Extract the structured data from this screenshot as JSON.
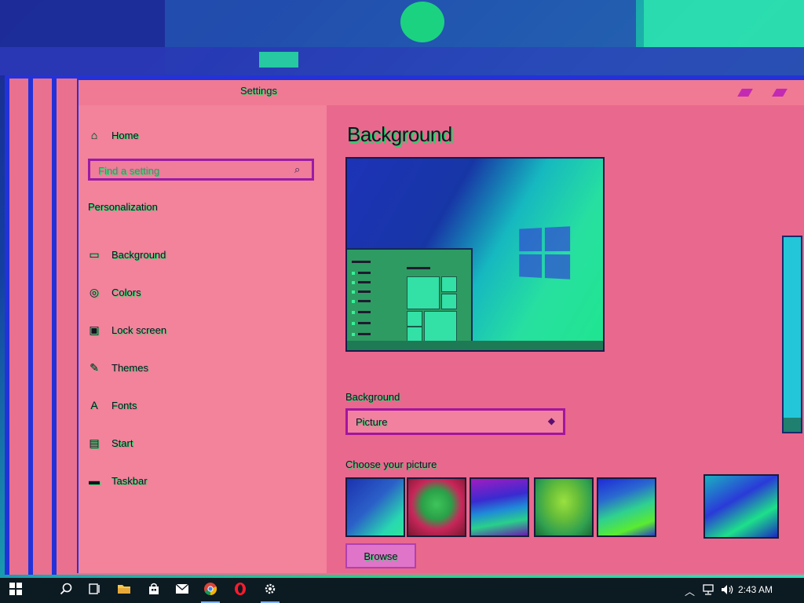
{
  "window": {
    "title": "Settings",
    "controls": {
      "minimize_icon": "minimize-icon",
      "maximize_icon": "maximize-icon",
      "close_icon": "close-icon"
    }
  },
  "sidebar": {
    "home_label": "Home",
    "search": {
      "placeholder": "Find a setting",
      "value": ""
    },
    "section_heading": "Personalization",
    "items": [
      {
        "label": "Background",
        "icon": "picture-icon",
        "selected": true
      },
      {
        "label": "Colors",
        "icon": "palette-icon",
        "selected": false
      },
      {
        "label": "Lock screen",
        "icon": "lock-screen-icon",
        "selected": false
      },
      {
        "label": "Themes",
        "icon": "brush-icon",
        "selected": false
      },
      {
        "label": "Fonts",
        "icon": "font-icon",
        "selected": false
      },
      {
        "label": "Start",
        "icon": "start-icon",
        "selected": false
      },
      {
        "label": "Taskbar",
        "icon": "taskbar-icon",
        "selected": false
      }
    ]
  },
  "content": {
    "page_title": "Background",
    "background_label": "Background",
    "background_select_value": "Picture",
    "choose_picture_label": "Choose your picture",
    "browse_label": "Browse"
  },
  "taskbar": {
    "clock": "2:43 AM",
    "pinned": [
      {
        "name": "start",
        "icon": "windows-logo-icon"
      },
      {
        "name": "search",
        "icon": "search-icon"
      },
      {
        "name": "task-view",
        "icon": "task-view-icon"
      },
      {
        "name": "file-explorer",
        "icon": "folder-icon"
      },
      {
        "name": "store",
        "icon": "store-icon"
      },
      {
        "name": "mail",
        "icon": "mail-icon"
      },
      {
        "name": "chrome",
        "icon": "chrome-icon"
      },
      {
        "name": "opera",
        "icon": "opera-icon"
      },
      {
        "name": "settings",
        "icon": "gear-icon"
      }
    ]
  },
  "colors": {
    "window_bg": "#f07a93",
    "accent_border": "#a3159e",
    "text_shadow": "#2bd76c",
    "taskbar_bg": "#0c1a22"
  }
}
